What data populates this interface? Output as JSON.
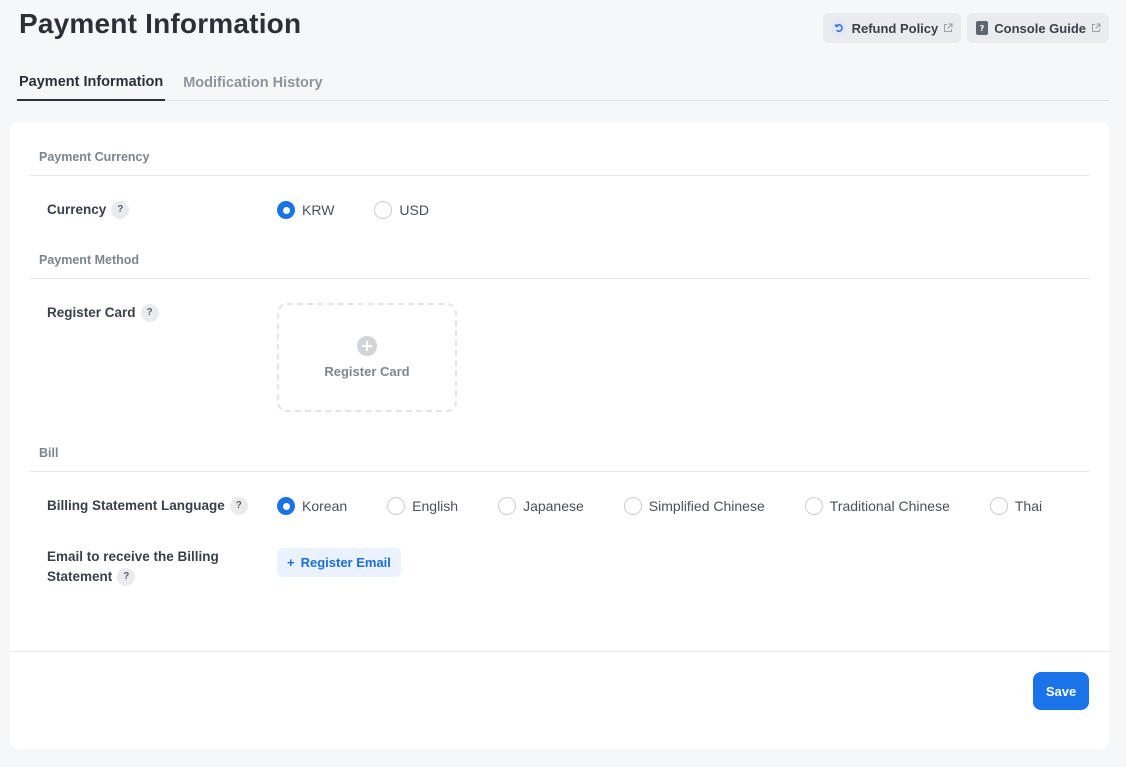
{
  "page": {
    "title": "Payment Information"
  },
  "top_actions": {
    "refund_policy": "Refund Policy",
    "console_guide": "Console Guide"
  },
  "tabs": [
    {
      "label": "Payment Information",
      "active": true
    },
    {
      "label": "Modification History",
      "active": false
    }
  ],
  "sections": {
    "payment_currency": "Payment Currency",
    "payment_method": "Payment Method",
    "bill": "Bill"
  },
  "currency": {
    "label": "Currency",
    "help": "?",
    "options": [
      {
        "label": "KRW",
        "checked": true
      },
      {
        "label": "USD",
        "checked": false
      }
    ]
  },
  "register_card": {
    "label": "Register Card",
    "help": "?",
    "button_label": "Register Card"
  },
  "billing_language": {
    "label": "Billing Statement Language",
    "help": "?",
    "options": [
      {
        "label": "Korean",
        "checked": true
      },
      {
        "label": "English",
        "checked": false
      },
      {
        "label": "Japanese",
        "checked": false
      },
      {
        "label": "Simplified Chinese",
        "checked": false
      },
      {
        "label": "Traditional Chinese",
        "checked": false
      },
      {
        "label": "Thai",
        "checked": false
      }
    ]
  },
  "email": {
    "label_line1": "Email to receive the Billing",
    "label_line2": "Statement",
    "help": "?",
    "button_label": "Register Email",
    "button_prefix": "+"
  },
  "footer": {
    "save_label": "Save"
  },
  "colors": {
    "accent": "#1a73e8",
    "background": "#f6f7f9"
  }
}
